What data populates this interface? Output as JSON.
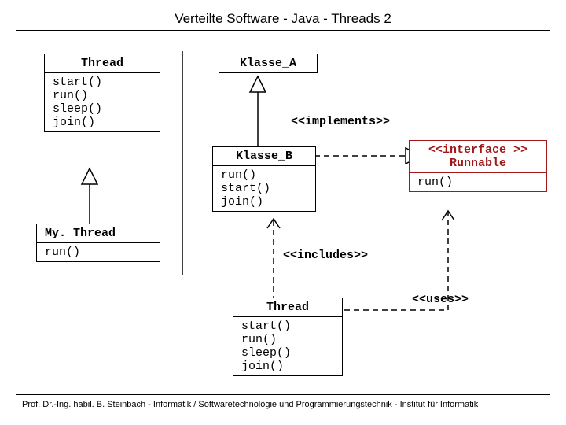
{
  "title": "Verteilte Software - Java - Threads 2",
  "footer": "Prof. Dr.-Ing. habil. B. Steinbach - Informatik / Softwaretechnologie und Programmierungstechnik - Institut für Informatik",
  "boxes": {
    "thread_top": {
      "name": "Thread",
      "methods": "start()\nrun()\nsleep()\njoin()"
    },
    "mythread": {
      "name": "My. Thread",
      "methods": "run()"
    },
    "klasse_a": {
      "name": "Klasse_A"
    },
    "klasse_b": {
      "name": "Klasse_B",
      "methods": "run()\nstart()\njoin()"
    },
    "runnable": {
      "head": "<<interface >>\nRunnable",
      "methods": "run()"
    },
    "thread_bottom": {
      "name": "Thread",
      "methods": "start()\nrun()\nsleep()\njoin()"
    }
  },
  "labels": {
    "implements": "<<implements>>",
    "includes": "<<includes>>",
    "uses": "<<uses>>"
  }
}
